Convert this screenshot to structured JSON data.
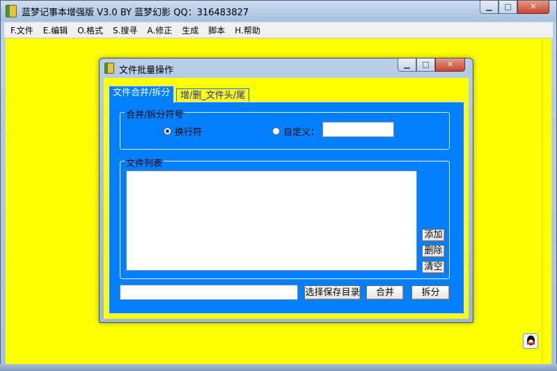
{
  "main_window": {
    "title": "蓝梦记事本增强版 V3.0 BY 蓝梦幻影 QQ：316483827",
    "controls": {
      "minimize": "▁",
      "maximize": "□",
      "close": "✕"
    }
  },
  "menubar": {
    "items": [
      {
        "label": "F.文件"
      },
      {
        "label": "E.编辑"
      },
      {
        "label": "O.格式"
      },
      {
        "label": "S.搜寻"
      },
      {
        "label": "A.修正"
      },
      {
        "label": "生成"
      },
      {
        "label": "脚本"
      },
      {
        "label": "H.帮助"
      }
    ]
  },
  "colors": {
    "client_background": "#ffff00",
    "dialog_panel": "#0080ff",
    "inactive_tab_text": "#2222cc"
  },
  "dialog": {
    "title": "文件批量操作",
    "controls": {
      "minimize": "▁",
      "maximize": "□",
      "close": "✕"
    },
    "tabs": [
      {
        "label": "文件合并/拆分",
        "active": true
      },
      {
        "label": "增/删_文件头/尾",
        "active": false
      }
    ],
    "separator_group": {
      "legend": "合并/拆分符号",
      "options": [
        {
          "label": "换行符",
          "checked": true
        },
        {
          "label": "自定义：",
          "checked": false
        }
      ],
      "custom_value": ""
    },
    "file_list_group": {
      "legend": "文件列表",
      "items": [],
      "buttons": {
        "add": "添加",
        "delete": "删除",
        "clear": "清空"
      }
    },
    "save_path": "",
    "buttons": {
      "choose_dir": "选择保存目录",
      "merge": "合并",
      "split": "拆分"
    }
  },
  "icons": {
    "app": "notebook-icon",
    "tray": "qq-penguin-icon"
  }
}
